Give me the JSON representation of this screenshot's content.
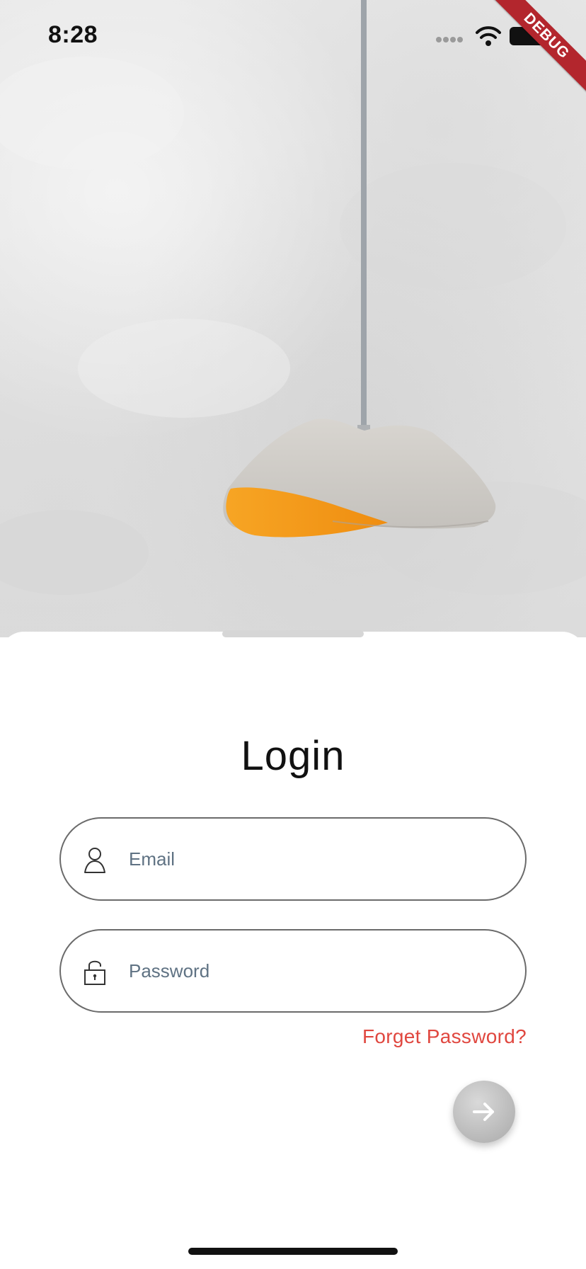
{
  "status_bar": {
    "time": "8:28",
    "icons": [
      "signal-dots-icon",
      "wifi-icon",
      "battery-icon"
    ]
  },
  "debug_banner": {
    "label": "DEBUG",
    "color": "#b3262d"
  },
  "hero": {
    "image": "pendant-lamp-on-concrete-wall",
    "lamp_accent": "#f39a1c"
  },
  "login": {
    "title": "Login",
    "email": {
      "icon": "person-icon",
      "placeholder": "Email",
      "value": ""
    },
    "password": {
      "icon": "lock-icon",
      "placeholder": "Password",
      "value": ""
    },
    "forget_password": "Forget Password?",
    "submit": {
      "icon": "arrow-right-icon"
    }
  },
  "colors": {
    "link": "#e0473f",
    "field_border": "#6b6b6b",
    "placeholder": "#5f7283"
  }
}
